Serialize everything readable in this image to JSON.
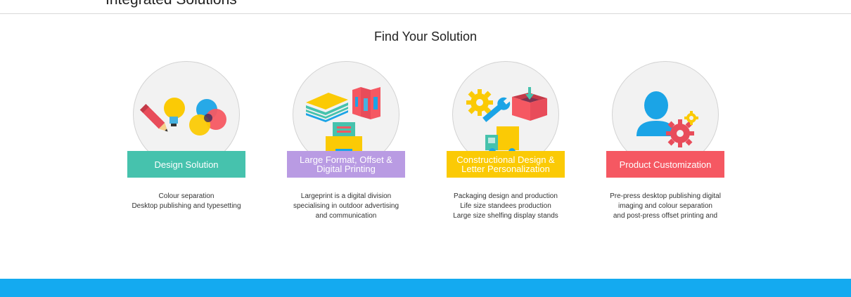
{
  "header": {
    "title": "Integrated Solutions"
  },
  "section": {
    "heading": "Find Your Solution"
  },
  "solutions": [
    {
      "label": "Design Solution",
      "color": "#46c2ad",
      "icon": "design-icon",
      "lines": [
        "Colour separation",
        "Desktop publishing and typesetting"
      ]
    },
    {
      "label": "Large Format, Offset & Digital Printing",
      "color": "#b99be3",
      "icon": "printing-icon",
      "lines": [
        "Largeprint is a digital division",
        "specialising in outdoor advertising",
        "and communication"
      ]
    },
    {
      "label": "Constructional Design & Letter Personalization",
      "color": "#fbca05",
      "icon": "construction-icon",
      "lines": [
        "Packaging design and production",
        "Life size standees production",
        "Large size shelfing display stands"
      ]
    },
    {
      "label": "Product Customization",
      "color": "#f55862",
      "icon": "customization-icon",
      "lines": [
        "Pre-press desktop publishing digital",
        "imaging and colour separation",
        "and post-press offset printing and"
      ]
    }
  ],
  "footer": {
    "color": "#14aaf0"
  }
}
